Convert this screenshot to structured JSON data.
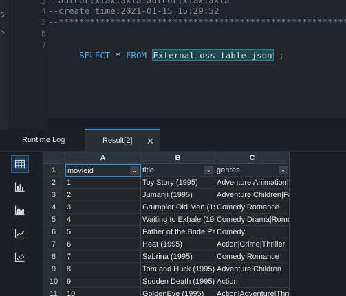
{
  "editor": {
    "left_gutter": [
      "5",
      "5"
    ],
    "line_numbers": [
      "3",
      "4",
      "5",
      "6",
      "7"
    ],
    "lines": [
      {
        "num": "3",
        "text": "--author:xiaxiaxia:author:xiaxiaxia",
        "kind": "comment"
      },
      {
        "num": "4",
        "text": "--create time:2021-01-15 15:29:52",
        "kind": "comment"
      },
      {
        "num": "5",
        "text": "--*************************************************************************",
        "kind": "comment"
      },
      {
        "num": "6",
        "text": "",
        "kind": "blank"
      }
    ],
    "sql": {
      "kw_select": "SELECT",
      "star": " * ",
      "kw_from": "FROM",
      "table": "External_oss_table_json",
      "end": " ;"
    }
  },
  "tabs": {
    "runtime_log": "Runtime Log",
    "result": "Result[2]",
    "close_glyph": "✕"
  },
  "rail": {
    "icons": [
      "table-view-icon",
      "bar-chart-icon",
      "area-chart-icon",
      "line-chart-icon",
      "scatter-chart-icon"
    ]
  },
  "grid": {
    "columns": [
      "A",
      "B",
      "C"
    ],
    "header_row_num": "1",
    "fields": [
      "movieid",
      "title",
      "genres"
    ],
    "dropdown_glyph": "⌄",
    "rows": [
      {
        "n": "2",
        "id": "1",
        "title": "Toy Story (1995)",
        "genres": "Adventure|Animation|C"
      },
      {
        "n": "3",
        "id": "2",
        "title": "Jumanji (1995)",
        "genres": "Adventure|Children|Far"
      },
      {
        "n": "4",
        "id": "3",
        "title": "Grumpier Old Men (199",
        "genres": "Comedy|Romance"
      },
      {
        "n": "5",
        "id": "4",
        "title": "Waiting to Exhale (199",
        "genres": "Comedy|Drama|Romar"
      },
      {
        "n": "6",
        "id": "5",
        "title": "Father of the Bride Par",
        "genres": "Comedy"
      },
      {
        "n": "7",
        "id": "6",
        "title": "Heat (1995)",
        "genres": "Action|Crime|Thriller"
      },
      {
        "n": "8",
        "id": "7",
        "title": "Sabrina (1995)",
        "genres": "Comedy|Romance"
      },
      {
        "n": "9",
        "id": "8",
        "title": "Tom and Huck (1995)",
        "genres": "Adventure|Children"
      },
      {
        "n": "10",
        "id": "9",
        "title": "Sudden Death (1995)",
        "genres": "Action"
      },
      {
        "n": "11",
        "id": "10",
        "title": "GoldenEye (1995)",
        "genres": "Action|Adventure|Thrill"
      }
    ]
  }
}
